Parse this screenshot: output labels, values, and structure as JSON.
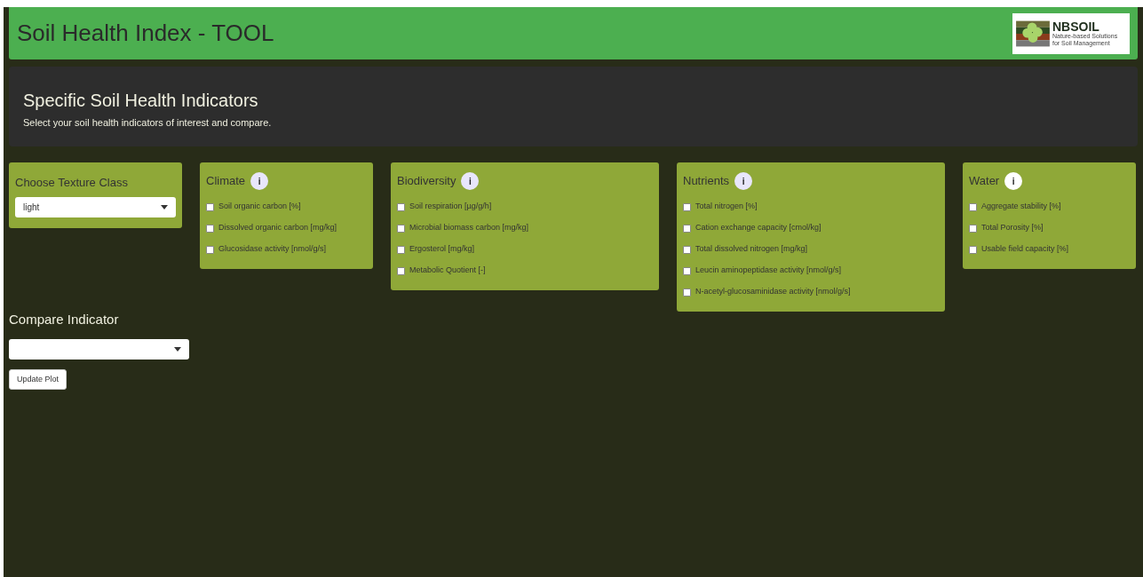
{
  "header": {
    "title": "Soil Health Index - TOOL",
    "logo": {
      "name": "NBSOIL",
      "tagline": "Nature-based Solutions for Soil Management"
    }
  },
  "intro": {
    "title": "Specific Soil Health Indicators",
    "subtitle": "Select your soil health indicators of interest and compare."
  },
  "texture": {
    "label": "Choose Texture Class",
    "value": "light"
  },
  "groups": [
    {
      "title": "Climate",
      "info": {
        "text": "i",
        "color": "#e8e6fb"
      },
      "items": [
        {
          "label": "Soil organic carbon [%]",
          "checked": false
        },
        {
          "label": "Dissolved organic carbon [mg/kg]",
          "checked": false
        },
        {
          "label": "Glucosidase activity [nmol/g/s]",
          "checked": false
        }
      ]
    },
    {
      "title": "Biodiversity",
      "info": {
        "text": "i",
        "color": "#e8e6fb"
      },
      "items": [
        {
          "label": "Soil respiration [µg/g/h]",
          "checked": false
        },
        {
          "label": "Microbial biomass carbon [mg/kg]",
          "checked": false
        },
        {
          "label": "Ergosterol [mg/kg]",
          "checked": false
        },
        {
          "label": "Metabolic Quotient [-]",
          "checked": false
        }
      ]
    },
    {
      "title": "Nutrients",
      "info": {
        "text": "i",
        "color": "#e8e6fb"
      },
      "items": [
        {
          "label": "Total nitrogen [%]",
          "checked": false
        },
        {
          "label": "Cation exchange capacity [cmol/kg]",
          "checked": false
        },
        {
          "label": "Total dissolved nitrogen [mg/kg]",
          "checked": false
        },
        {
          "label": "Leucin aminopeptidase activity [nmol/g/s]",
          "checked": false
        },
        {
          "label": "N-acetyl-glucosaminidase activity [nmol/g/s]",
          "checked": false
        }
      ]
    },
    {
      "title": "Water",
      "info": {
        "text": "i",
        "color": "#ffffff"
      },
      "items": [
        {
          "label": "Aggregate stability [%]",
          "checked": false
        },
        {
          "label": "Total Porosity [%]",
          "checked": false
        },
        {
          "label": "Usable field capacity [%]",
          "checked": false
        }
      ]
    }
  ],
  "compare": {
    "label": "Compare Indicator",
    "button": "Update Plot"
  }
}
